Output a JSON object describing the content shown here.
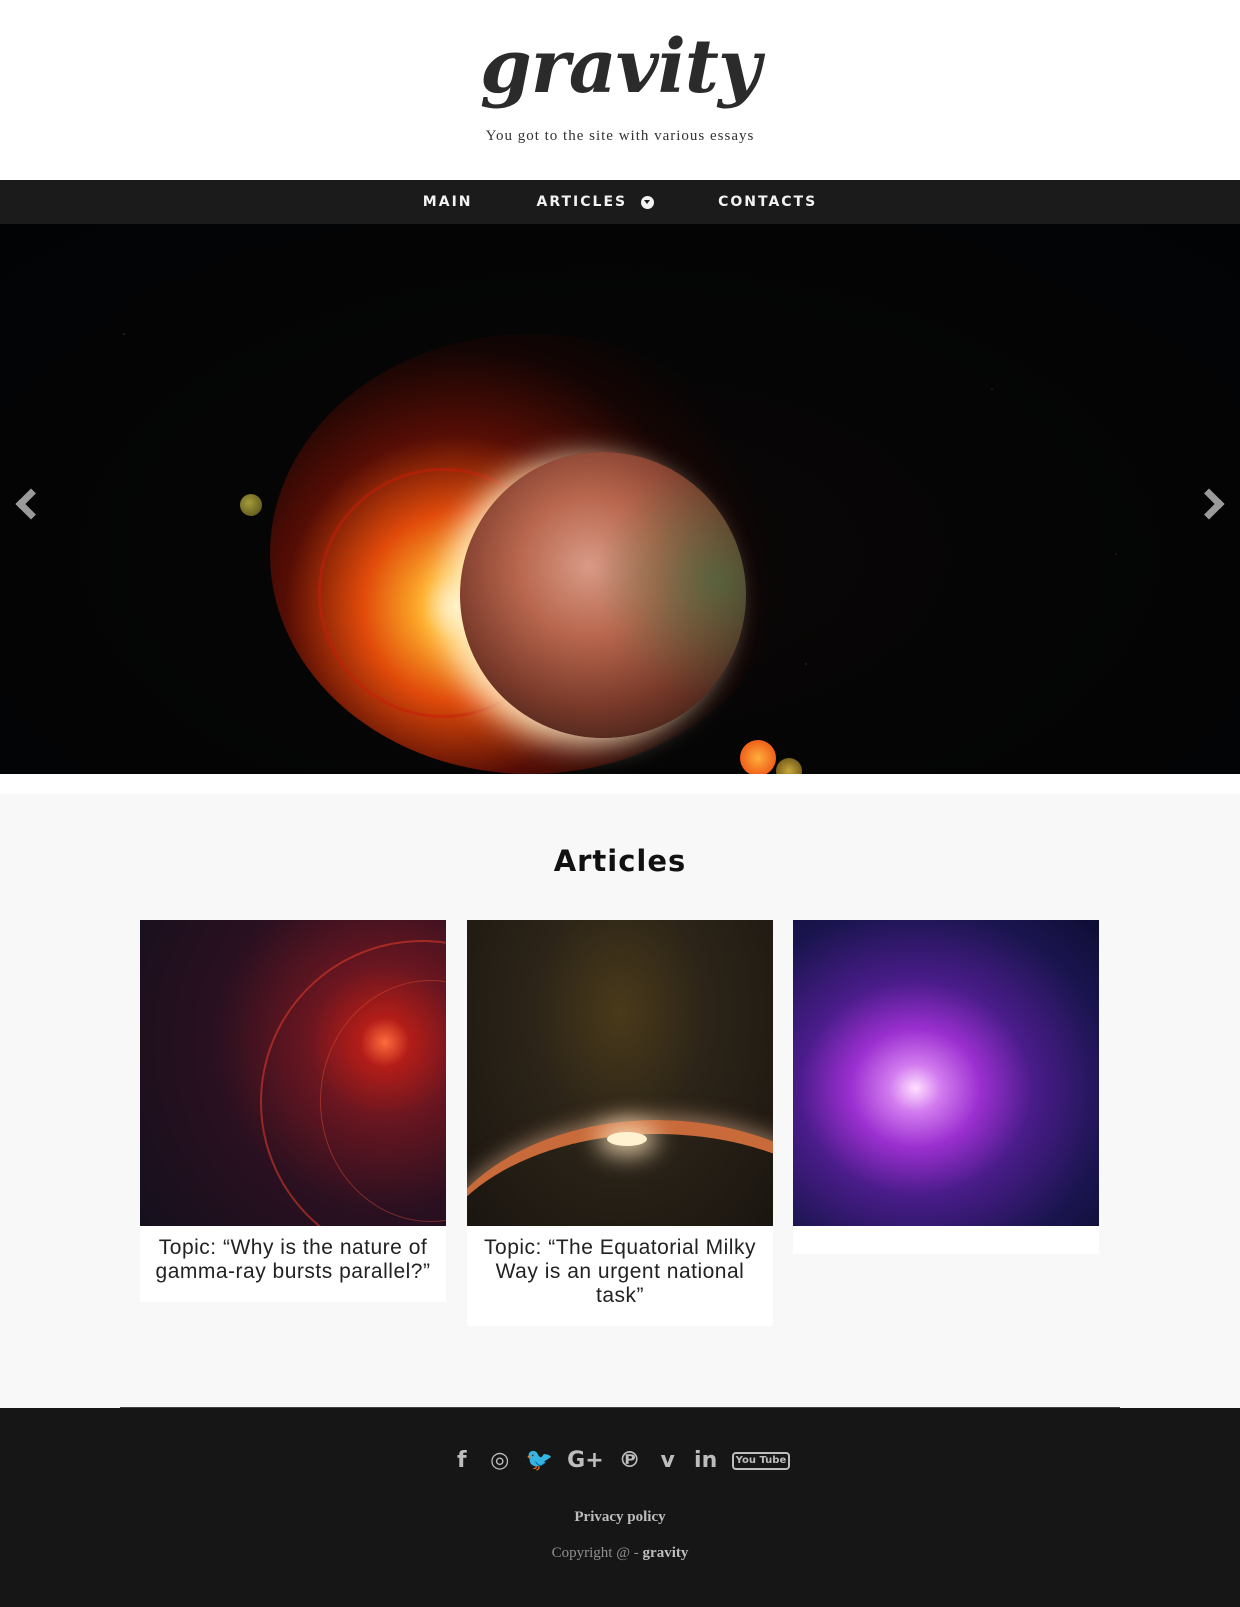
{
  "header": {
    "logo": "gravity",
    "tagline": "You got to the site with various essays"
  },
  "nav": {
    "items": [
      {
        "label": "MAIN"
      },
      {
        "label": "ARTICLES"
      },
      {
        "label": "CONTACTS"
      }
    ]
  },
  "hero": {
    "prev_icon": "chevron-left-icon",
    "next_icon": "chevron-right-icon"
  },
  "articles": {
    "title": "Articles",
    "cards": [
      {
        "caption": "Topic: “Why is the nature of gamma-ray bursts parallel?”"
      },
      {
        "caption": "Topic: “The Equatorial Milky Way is an urgent national task”"
      },
      {
        "caption": ""
      }
    ]
  },
  "footer": {
    "socials": [
      {
        "name": "facebook-icon",
        "glyph": "f"
      },
      {
        "name": "instagram-icon",
        "glyph": "◎"
      },
      {
        "name": "twitter-icon",
        "glyph": "🐦"
      },
      {
        "name": "google-plus-icon",
        "glyph": "G+"
      },
      {
        "name": "pinterest-icon",
        "glyph": "℗"
      },
      {
        "name": "vimeo-icon",
        "glyph": "v"
      },
      {
        "name": "linkedin-icon",
        "glyph": "in"
      },
      {
        "name": "youtube-icon",
        "glyph": "You Tube"
      }
    ],
    "privacy": "Privacy policy",
    "copyright_prefix": "Copyright @ -",
    "copyright_brand": "gravity"
  }
}
